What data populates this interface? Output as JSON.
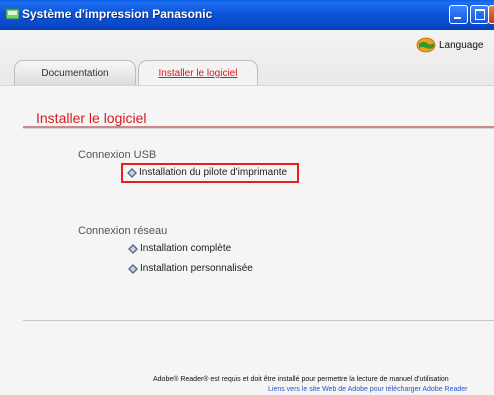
{
  "window": {
    "title": "Système d'impression Panasonic"
  },
  "header": {
    "language_label": "Language"
  },
  "tabs": [
    {
      "label": "Documentation",
      "active": false
    },
    {
      "label": "Installer le logiciel",
      "active": true
    }
  ],
  "main": {
    "heading": "Installer le logiciel",
    "usb_section": {
      "label": "Connexion USB",
      "links": [
        "Installation du pilote d'imprimante"
      ]
    },
    "network_section": {
      "label": "Connexion réseau",
      "links": [
        "Installation complète",
        "Installation personnalisée"
      ]
    },
    "footer_note": "Adobe® Reader® est requis et doit être installé pour permettre la lecture de manuel d'utilisation",
    "footer_link": "Liens vers le site Web de Adobe pour télécharger Adobe Reader"
  },
  "colors": {
    "accent_red": "#d41a1a",
    "titlebar_blue": "#0b54d9",
    "highlight_box": "#e41d1d"
  },
  "icons": [
    "app-icon",
    "minimize-icon",
    "maximize-icon",
    "close-icon",
    "globe-icon",
    "diamond-bullet-icon"
  ]
}
